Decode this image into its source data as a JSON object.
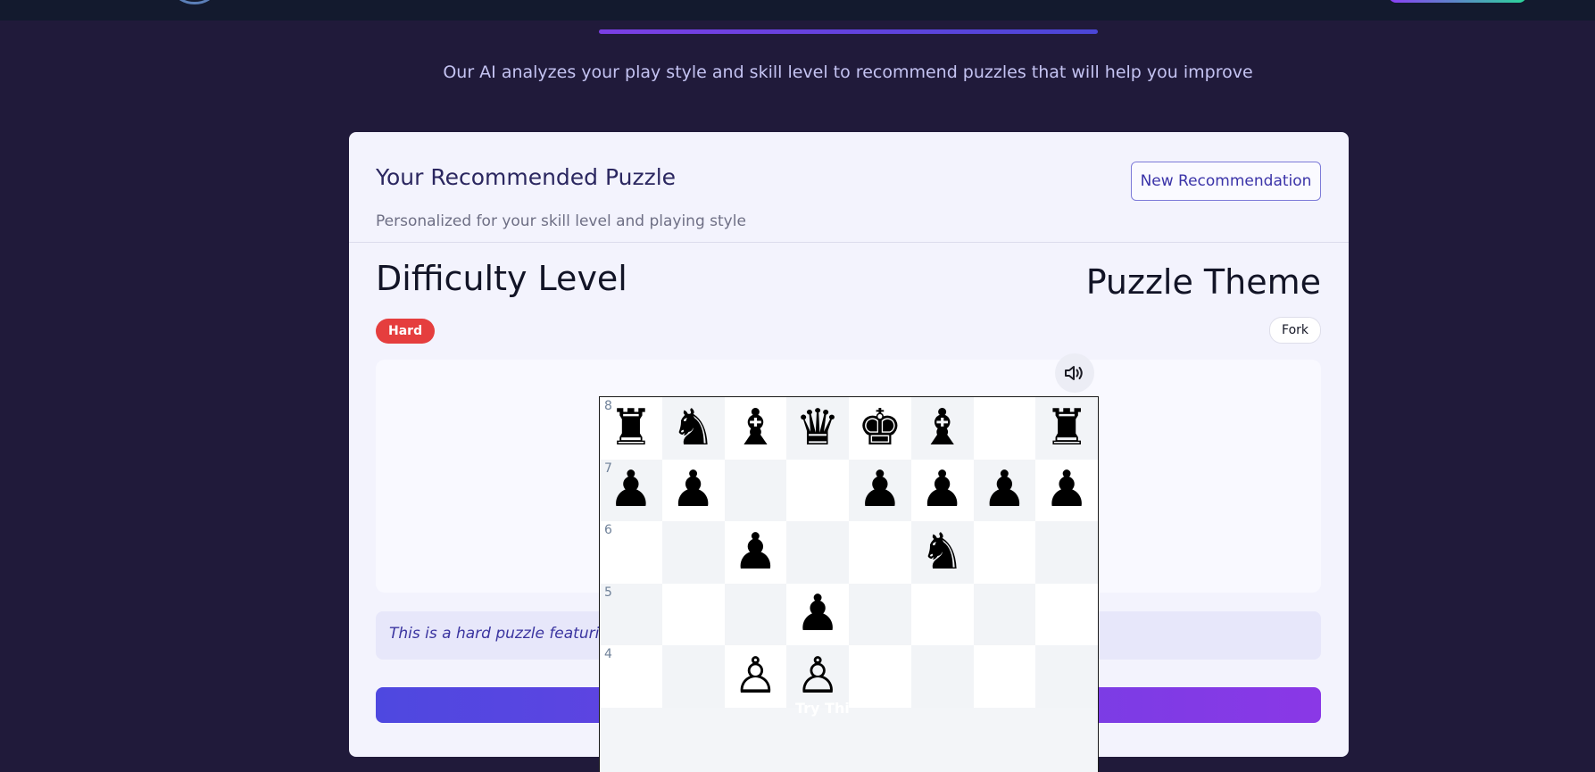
{
  "intro": "Our AI analyzes your play style and skill level to recommend puzzles that will help you improve",
  "card": {
    "title": "Your Recommended Puzzle",
    "subtitle": "Personalized for your skill level and playing style",
    "new_button": "New Recommendation",
    "difficulty_heading": "Difficulty Level",
    "difficulty_value": "Hard",
    "theme_heading": "Puzzle Theme",
    "theme_value": "Fork",
    "description": "This is a hard puzzle featuring a fork tactic that matches your skill level.",
    "try_label": "Try Thi"
  },
  "colors": {
    "page_bg": "#201a3a",
    "accent": "#4e48e0",
    "hard_badge": "#e53e3e"
  },
  "icons": {
    "sound": "speaker-volume-icon"
  },
  "board": {
    "ranks": [
      "8",
      "7",
      "6",
      "5",
      "4"
    ],
    "rows": [
      [
        "♜",
        "♞",
        "♝",
        "♛",
        "♚",
        "♝",
        "",
        "♜"
      ],
      [
        "♟",
        "♟",
        "",
        "",
        "♟",
        "♟",
        "♟",
        "♟"
      ],
      [
        "",
        "",
        "♟",
        "",
        "",
        "♞",
        "",
        ""
      ],
      [
        "",
        "",
        "",
        "♟",
        "",
        "",
        "",
        ""
      ],
      [
        "",
        "",
        "♙",
        "♙",
        "",
        "",
        "",
        ""
      ]
    ]
  }
}
